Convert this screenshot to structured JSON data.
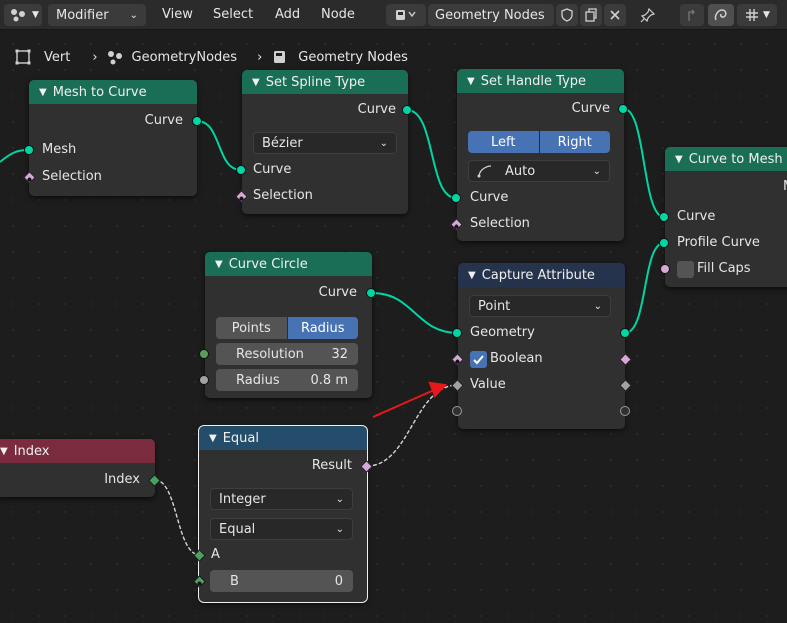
{
  "header": {
    "editor_type_icon": "node-editor-icon",
    "mode": "Modifier",
    "menus": [
      "View",
      "Select",
      "Add",
      "Node"
    ],
    "tree_icon": "node-tree-icon",
    "tree_name": "Geometry Nodes"
  },
  "breadcrumb": [
    "Vert",
    "GeometryNodes",
    "Geometry Nodes"
  ],
  "nodes": {
    "mesh_to_curve": {
      "title": "Mesh to Curve",
      "out_curve": "Curve",
      "in_mesh": "Mesh",
      "in_selection": "Selection"
    },
    "set_spline_type": {
      "title": "Set Spline Type",
      "out_curve": "Curve",
      "spline_type": "Bézier",
      "in_curve": "Curve",
      "in_selection": "Selection"
    },
    "set_handle_type": {
      "title": "Set Handle Type",
      "out_curve": "Curve",
      "left": "Left",
      "right": "Right",
      "handle": "Auto",
      "in_curve": "Curve",
      "in_selection": "Selection"
    },
    "curve_to_mesh": {
      "title": "Curve to Mesh",
      "out_mesh": "M",
      "in_curve": "Curve",
      "in_profile": "Profile Curve",
      "fill_caps": "Fill Caps"
    },
    "curve_circle": {
      "title": "Curve Circle",
      "out_curve": "Curve",
      "mode_points": "Points",
      "mode_radius": "Radius",
      "resolution_label": "Resolution",
      "resolution_value": "32",
      "radius_label": "Radius",
      "radius_value": "0.8 m"
    },
    "capture_attribute": {
      "title": "Capture Attribute",
      "domain": "Point",
      "geometry": "Geometry",
      "boolean": "Boolean",
      "value": "Value"
    },
    "index": {
      "title": "Index",
      "out_index": "Index"
    },
    "equal": {
      "title": "Equal",
      "out_result": "Result",
      "data_type": "Integer",
      "operation": "Equal",
      "in_a": "A",
      "in_b": "B",
      "b_value": "0"
    }
  },
  "colors": {
    "geometry_socket": "#00d6a3",
    "field_socket": "#d6a8d8",
    "selected_blue": "#4772b3",
    "annotation_arrow": "#e8171c"
  }
}
